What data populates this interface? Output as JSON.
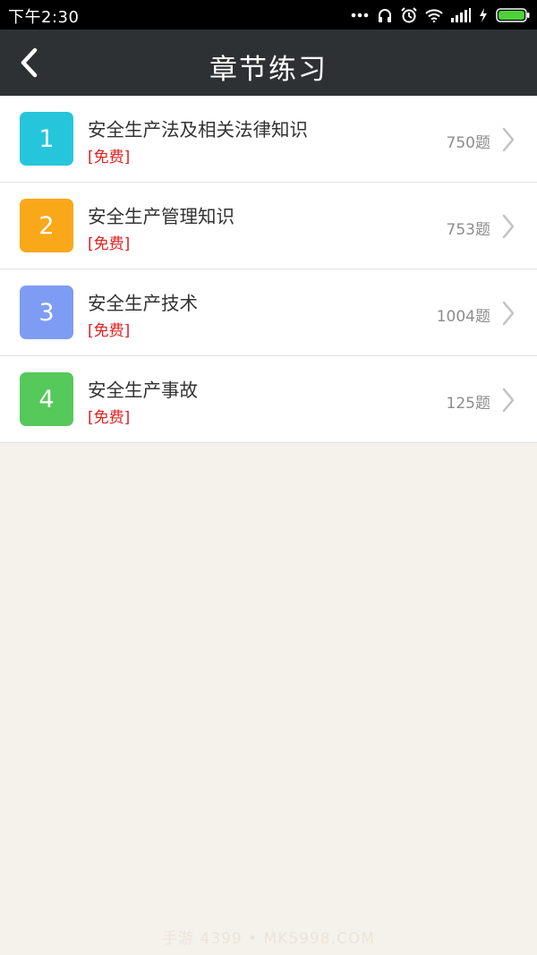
{
  "status_bar": {
    "time": "下午2:30",
    "icons": [
      "more-dots-icon",
      "headset-icon",
      "alarm-icon",
      "wifi-icon",
      "signal-icon",
      "charging-icon",
      "battery-icon"
    ],
    "battery_color": "#4cd137"
  },
  "header": {
    "title": "章节练习",
    "back_icon": "chevron-left-icon",
    "background": "#2e3133"
  },
  "chapters": [
    {
      "number": "1",
      "title": "安全生产法及相关法律知识",
      "tag": "[免费]",
      "count": "750题",
      "color": "#25c6dc"
    },
    {
      "number": "2",
      "title": "安全生产管理知识",
      "tag": "[免费]",
      "count": "753题",
      "color": "#f9a81a"
    },
    {
      "number": "3",
      "title": "安全生产技术",
      "tag": "[免费]",
      "count": "1004题",
      "color": "#7f9cf4"
    },
    {
      "number": "4",
      "title": "安全生产事故",
      "tag": "[免费]",
      "count": "125题",
      "color": "#55c95a"
    }
  ],
  "watermark": "手游 4399 • MK5998.COM"
}
